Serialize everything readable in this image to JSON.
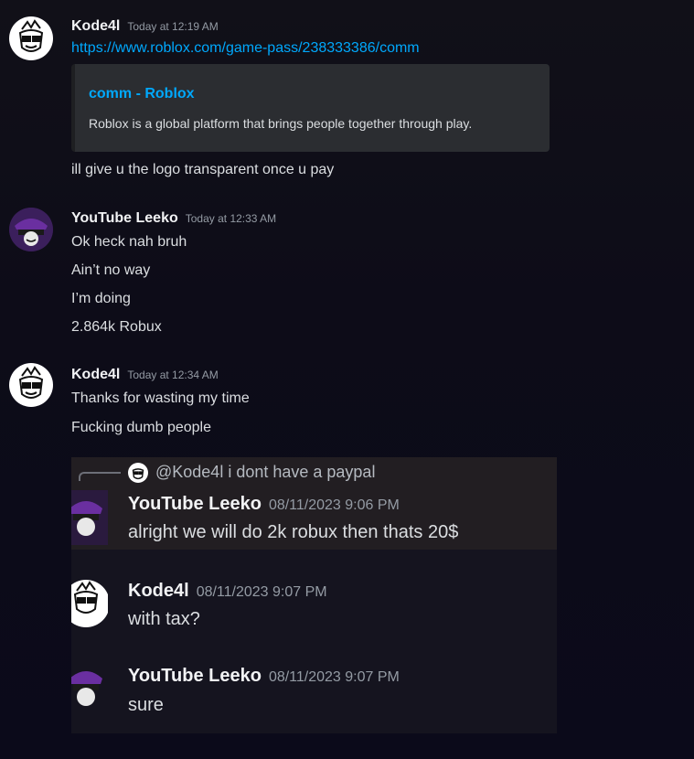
{
  "messages": [
    {
      "author": "Kode4l",
      "timestamp": "Today at 12:19 AM",
      "link": "https://www.roblox.com/game-pass/238333386/comm",
      "embed": {
        "title": "comm - Roblox",
        "description": "Roblox is a global platform that brings people together through play."
      },
      "lines": [
        "ill give u the logo transparent once u pay"
      ]
    },
    {
      "author": "YouTube Leeko",
      "timestamp": "Today at 12:33 AM",
      "lines": [
        "Ok heck nah bruh",
        "Ain’t no way",
        "I’m doing",
        "2.864k Robux"
      ]
    },
    {
      "author": "Kode4l",
      "timestamp": "Today at 12:34 AM",
      "lines": [
        "Thanks for wasting my time",
        "Fucking dumb people"
      ]
    }
  ],
  "screenshot": {
    "reply_text": "@Kode4l i dont have a paypal",
    "messages": [
      {
        "author": "YouTube Leeko",
        "timestamp": "08/11/2023 9:06 PM",
        "text": "alright we will do 2k robux then thats 20$"
      },
      {
        "author": "Kode4l",
        "timestamp": "08/11/2023 9:07 PM",
        "text": "with tax?"
      },
      {
        "author": "YouTube Leeko",
        "timestamp": "08/11/2023 9:07 PM",
        "text": "sure"
      }
    ]
  },
  "colors": {
    "background": "#0d0c18",
    "link": "#00a8fc",
    "username": "#f2f3f5",
    "timestamp": "#949ba4",
    "embed_bg": "#2b2d31"
  }
}
